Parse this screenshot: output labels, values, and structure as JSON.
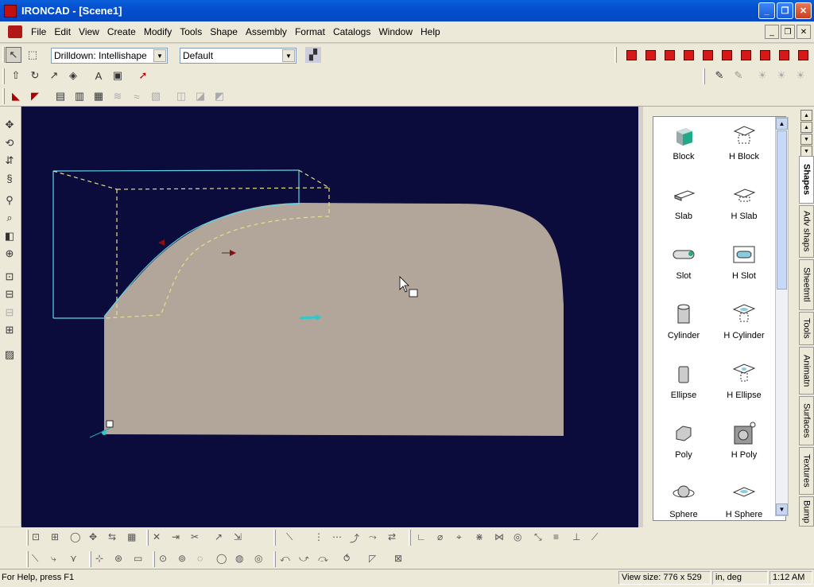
{
  "window": {
    "title": "IRONCAD - [Scene1]",
    "min_glyph": "_",
    "max_glyph": "❐",
    "close_glyph": "✕"
  },
  "menu": [
    "File",
    "Edit",
    "View",
    "Create",
    "Modify",
    "Tools",
    "Shape",
    "Assembly",
    "Format",
    "Catalogs",
    "Window",
    "Help"
  ],
  "toolbar": {
    "drilldown_value": "Drilldown: Intellishape",
    "style_value": "Default"
  },
  "catalog": {
    "items": [
      {
        "left": "Block",
        "right": "H Block"
      },
      {
        "left": "Slab",
        "right": "H Slab"
      },
      {
        "left": "Slot",
        "right": "H Slot"
      },
      {
        "left": "Cylinder",
        "right": "H Cylinder"
      },
      {
        "left": "Ellipse",
        "right": "H Ellipse"
      },
      {
        "left": "Poly",
        "right": "H Poly"
      },
      {
        "left": "Sphere",
        "right": "H Sphere"
      }
    ],
    "tabs": [
      "Shapes",
      "Adv shaps",
      "Sheetmtl",
      "Tools",
      "Animatn",
      "Surfaces",
      "Textures",
      "Bump"
    ]
  },
  "status": {
    "help": "For Help, press F1",
    "view_size": "View size:  776 x  529",
    "units": "in, deg",
    "time": "1:12 AM"
  },
  "colors": {
    "viewport_bg": "#0b0b3c",
    "part_fill": "#b2a69b",
    "bbox_color": "#5fd6e8",
    "dashed_color": "#e6e08a",
    "accent_red": "#d81818"
  }
}
